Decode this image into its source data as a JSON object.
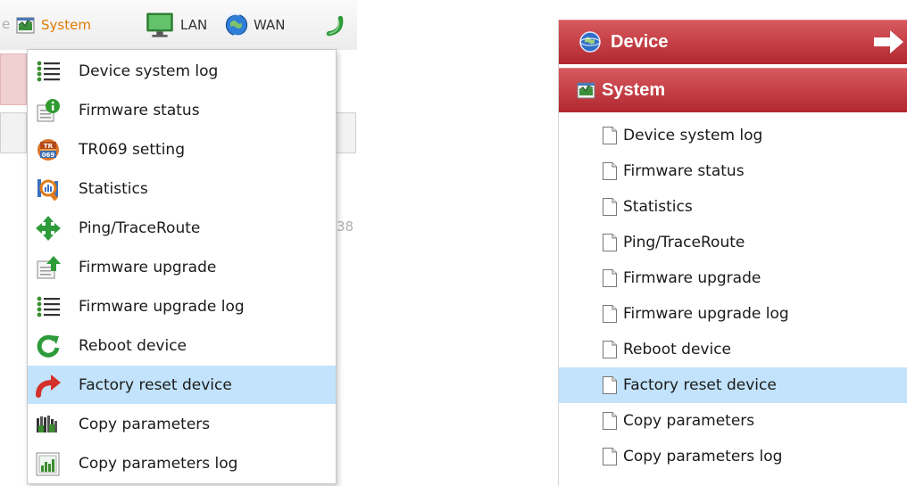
{
  "topbar": {
    "bg_fragment": "e",
    "bg_digits": "38",
    "menus": {
      "system": {
        "label": "System",
        "icon": "system-chart-icon"
      },
      "lan": {
        "label": "LAN",
        "icon": "monitor-icon"
      },
      "wan": {
        "label": "WAN",
        "icon": "globe-arrows-icon"
      }
    }
  },
  "dropdown": {
    "highlight_color": "#c2e3fb",
    "items": [
      {
        "label": "Device system log",
        "icon": "list-icon"
      },
      {
        "label": "Firmware status",
        "icon": "info-icon"
      },
      {
        "label": "TR069 setting",
        "icon": "tr069-icon"
      },
      {
        "label": "Statistics",
        "icon": "statistics-icon"
      },
      {
        "label": "Ping/TraceRoute",
        "icon": "move-arrows-icon"
      },
      {
        "label": "Firmware upgrade",
        "icon": "upload-icon"
      },
      {
        "label": "Firmware upgrade log",
        "icon": "list-icon"
      },
      {
        "label": "Reboot device",
        "icon": "refresh-icon"
      },
      {
        "label": "Factory reset device",
        "icon": "redo-arrow-icon",
        "highlighted": true
      },
      {
        "label": "Copy parameters",
        "icon": "copy-params-icon"
      },
      {
        "label": "Copy parameters log",
        "icon": "bar-chart-icon"
      }
    ]
  },
  "sidepanel": {
    "header_color": "#c23a41",
    "device_header": {
      "label": "Device",
      "icon": "device-globe-icon",
      "arrow": "arrow-right-icon"
    },
    "system_header": {
      "label": "System",
      "icon": "system-chart-icon"
    },
    "items": [
      {
        "label": "Device system log"
      },
      {
        "label": "Firmware status"
      },
      {
        "label": "Statistics"
      },
      {
        "label": "Ping/TraceRoute"
      },
      {
        "label": "Firmware upgrade"
      },
      {
        "label": "Firmware upgrade log"
      },
      {
        "label": "Reboot device"
      },
      {
        "label": "Factory reset device",
        "highlighted": true
      },
      {
        "label": "Copy parameters"
      },
      {
        "label": "Copy parameters log"
      }
    ]
  }
}
